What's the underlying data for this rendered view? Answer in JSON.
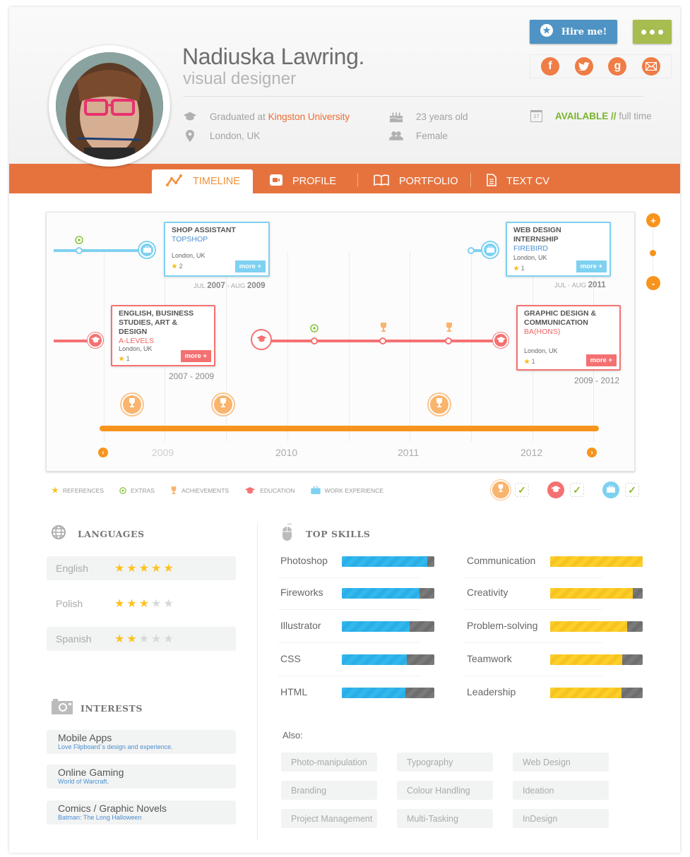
{
  "profile": {
    "name": "Nadiuska Lawring.",
    "role": "visual designer",
    "education_prefix": "Graduated at ",
    "education_school": "Kingston University",
    "location": "London, UK",
    "age": "23 years old",
    "gender": "Female",
    "availability_status": "AVAILABLE //",
    "availability_type": " full time",
    "calendar_day": "17"
  },
  "actions": {
    "hire_label": "Hire me!",
    "social": [
      "facebook",
      "twitter",
      "google-plus",
      "email"
    ]
  },
  "tabs": [
    {
      "label": "TIMELINE",
      "active": true
    },
    {
      "label": "PROFILE",
      "active": false
    },
    {
      "label": "PORTFOLIO",
      "active": false
    },
    {
      "label": "TEXT CV",
      "active": false
    }
  ],
  "timeline": {
    "work": [
      {
        "title": "SHOP ASSISTANT",
        "company": "TOPSHOP",
        "location": "London, UK",
        "references": "2",
        "more": "more +",
        "date_m1": "JUL ",
        "date_y1": "2007",
        "date_m2": " - AUG ",
        "date_y2": "2009"
      },
      {
        "title": "WEB DESIGN INTERNSHIP",
        "company": "FIREBIRD",
        "location": "London, UK",
        "references": "1",
        "more": "more +",
        "date_m": "JUL - AUG ",
        "date_y": "2011"
      }
    ],
    "education": [
      {
        "title_line1": "ENGLISH, BUSINESS",
        "title_line2": "STUDIES, ART & DESIGN",
        "qualification": "A-LEVELS",
        "location": "London, UK",
        "references": "1",
        "more": "more +",
        "dates": "2007 - 2009"
      },
      {
        "title_line1": "GRAPHIC DESIGN &",
        "title_line2": "COMMUNICATION",
        "qualification": "BA(HONS)",
        "location": "London, UK",
        "references": "1",
        "more": "more +",
        "dates": "2009 - 2012"
      }
    ],
    "years": [
      "2009",
      "2010",
      "2011",
      "2012"
    ],
    "legend": [
      "REFERENCES",
      "EXTRAS",
      "ACHIEVEMENTS",
      "EDUCATION",
      "WORK EXPERIENCE"
    ],
    "filters": [
      {
        "type": "achievements",
        "checked": true
      },
      {
        "type": "education",
        "checked": true
      },
      {
        "type": "work-experience",
        "checked": true
      }
    ]
  },
  "languages": {
    "title": "LANGUAGES",
    "items": [
      {
        "name": "English",
        "rating": 5,
        "max": 5
      },
      {
        "name": "Polish",
        "rating": 3,
        "max": 5
      },
      {
        "name": "Spanish",
        "rating": 2,
        "max": 5
      }
    ]
  },
  "interests": {
    "title": "INTERESTS",
    "items": [
      {
        "name": "Mobile Apps",
        "detail": "Love Flipboard´s design and experience."
      },
      {
        "name": "Online Gaming",
        "detail": "World of Warcraft."
      },
      {
        "name": "Comics / Graphic Novels",
        "detail": "Batman: The Long Halloween"
      }
    ]
  },
  "skills": {
    "title": "TOP SKILLS",
    "technical": [
      {
        "name": "Photoshop",
        "level": 0.92
      },
      {
        "name": "Fireworks",
        "level": 0.84
      },
      {
        "name": "Illustrator",
        "level": 0.73
      },
      {
        "name": "CSS",
        "level": 0.7
      },
      {
        "name": "HTML",
        "level": 0.69
      }
    ],
    "soft": [
      {
        "name": "Communication",
        "level": 1.0
      },
      {
        "name": "Creativity",
        "level": 0.89
      },
      {
        "name": "Problem-solving",
        "level": 0.83
      },
      {
        "name": "Teamwork",
        "level": 0.78
      },
      {
        "name": "Leadership",
        "level": 0.77
      }
    ],
    "also_label": "Also:",
    "also": [
      "Photo-manipulation",
      "Typography",
      "Web Design",
      "Branding",
      "Colour Handling",
      "Ideation",
      "Project Management",
      "Multi-Tasking",
      "InDesign"
    ]
  },
  "colors": {
    "accent_orange": "#e6733e",
    "work_blue": "#7ed1f1",
    "education_red": "#f57171",
    "achievement_orange": "#f7941d",
    "available_green": "#78b42a",
    "hire_blue": "#4f93c4",
    "more_green": "#a7bd4f"
  }
}
